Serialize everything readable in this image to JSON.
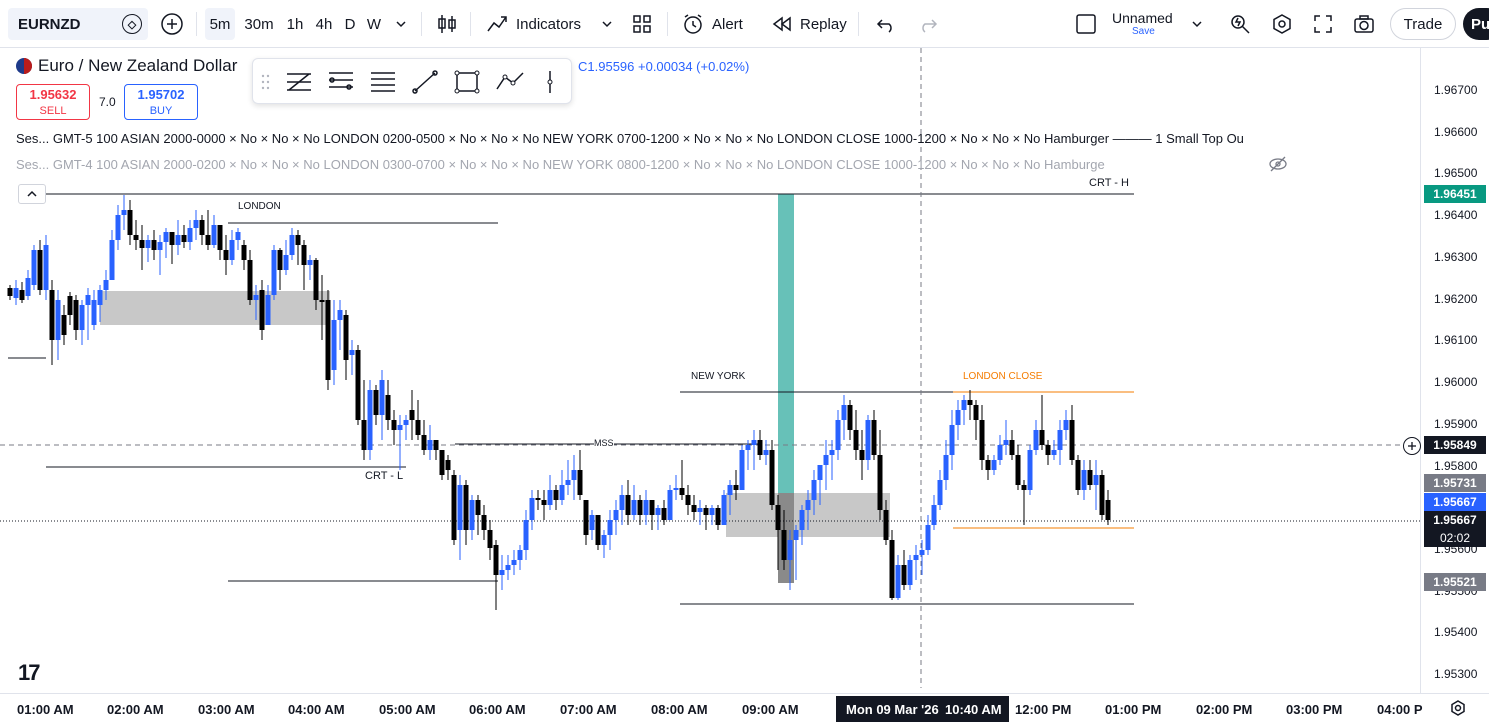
{
  "toolbar": {
    "symbol": "EURNZD",
    "timeframes": [
      "5m",
      "30m",
      "1h",
      "4h",
      "D",
      "W"
    ],
    "active_timeframe": "5m",
    "indicators_label": "Indicators",
    "alert_label": "Alert",
    "replay_label": "Replay",
    "layout_name": "Unnamed",
    "layout_save": "Save",
    "trade_label": "Trade",
    "publish_label": "Pu"
  },
  "legend": {
    "title": "Euro / New Zealand Dollar",
    "ohlc_text": "C1.95596 +0.00034 (+0.02%)",
    "sell_price": "1.95632",
    "sell_label": "SELL",
    "spread": "7.0",
    "buy_price": "1.95702",
    "buy_label": "BUY",
    "session1": "Ses... GMT-5 100 ASIAN 2000-0000 × No × No × No LONDON 0200-0500 × No × No × No NEW YORK 0700-1200 × No × No × No LONDON CLOSE 1000-1200 × No × No × No Hamburger ——— 1 Small Top Ou",
    "session2": "Ses... GMT-4 100 ASIAN 2000-0200 × No × No × No LONDON 0300-0700 × No × No × No NEW YORK 0800-1200 × No × No × No LONDON CLOSE 1000-1200 × No × No × No Hamburge"
  },
  "price_axis": {
    "ticks": [
      "1.96700",
      "1.96600",
      "1.96500",
      "1.96400",
      "1.96300",
      "1.96200",
      "1.96100",
      "1.96000",
      "1.95900",
      "1.95800",
      "1.95600",
      "1.95500",
      "1.95400",
      "1.95300"
    ],
    "tags": [
      {
        "value": "1.96451",
        "color": "#089981"
      },
      {
        "value": "1.95849",
        "color": "#131722"
      },
      {
        "value": "1.95731",
        "color": "#787b86"
      },
      {
        "value": "1.95667",
        "color": "#2962ff"
      },
      {
        "value": "1.95667",
        "color": "#131722"
      },
      {
        "value": "1.95521",
        "color": "#787b86"
      }
    ],
    "countdown": "02:02"
  },
  "time_axis": {
    "labels": [
      "01:00 AM",
      "02:00 AM",
      "03:00 AM",
      "04:00 AM",
      "05:00 AM",
      "06:00 AM",
      "07:00 AM",
      "08:00 AM",
      "09:00 AM",
      "12:00 PM",
      "01:00 PM",
      "02:00 PM",
      "03:00 PM",
      "04:00 P"
    ],
    "cursor_date": "Mon 09 Mar '26",
    "cursor_time": "10:40 AM"
  },
  "annotations": {
    "london": "LONDON",
    "new_york": "NEW YORK",
    "london_close": "LONDON CLOSE",
    "crt_h": "CRT - H",
    "crt_l": "CRT - L",
    "mss": "MSS"
  },
  "colors": {
    "bull": "#2962ff",
    "bear": "#000000",
    "killzone": "#26a69a",
    "orange_line": "#f57c00"
  }
}
